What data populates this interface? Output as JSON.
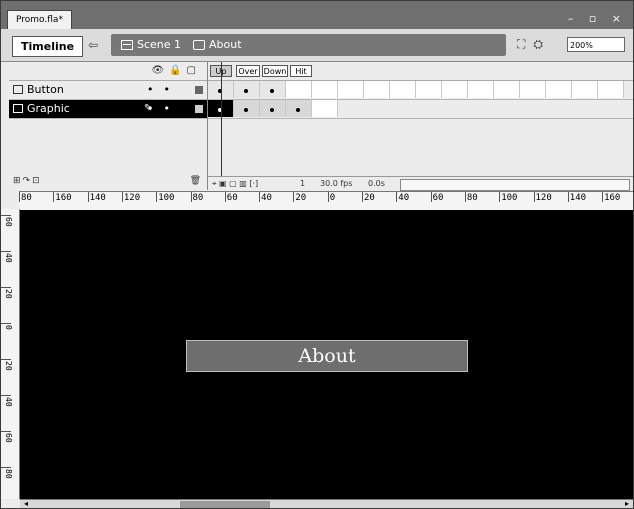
{
  "document": {
    "tab_title": "Promo.fla*"
  },
  "edit_bar": {
    "timeline_label": "Timeline",
    "scene_label": "Scene 1",
    "symbol_label": "About",
    "zoom": "200%"
  },
  "layers": [
    {
      "name": "Button",
      "selected": false
    },
    {
      "name": "Graphic",
      "selected": true
    }
  ],
  "states": [
    "Up",
    "Over",
    "Down",
    "Hit"
  ],
  "timeline_status": {
    "frame": "1",
    "fps": "30.0 fps",
    "time": "0.0s"
  },
  "ruler_top": [
    "80",
    "160",
    "140",
    "120",
    "100",
    "80",
    "60",
    "40",
    "20",
    "0",
    "20",
    "40",
    "60",
    "80",
    "100",
    "120",
    "140",
    "160"
  ],
  "ruler_left": [
    "60",
    "40",
    "20",
    "0",
    "20",
    "40",
    "60",
    "80"
  ],
  "stage": {
    "button_text": "About",
    "background": "#000000",
    "button_fill": "#6e6e6e"
  }
}
